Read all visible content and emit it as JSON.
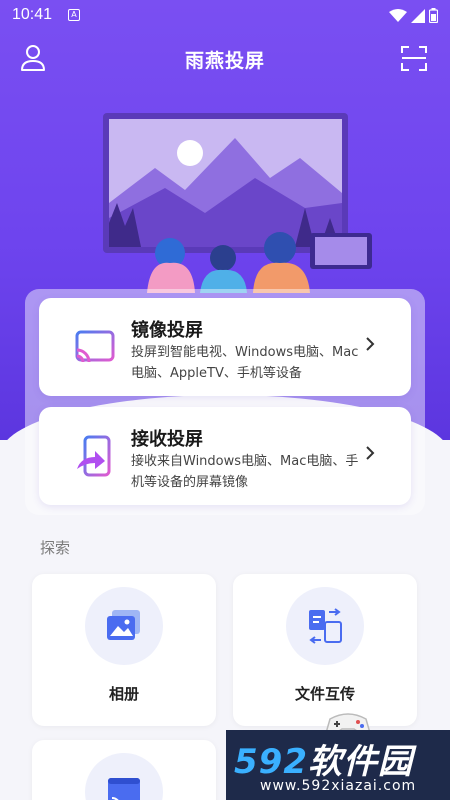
{
  "status_bar": {
    "time": "10:41",
    "app_indicator": "A"
  },
  "header": {
    "title": "雨燕投屏",
    "left_icon": "user-icon",
    "right_icon": "scan-icon"
  },
  "cards": [
    {
      "title": "镜像投屏",
      "desc": "投屏到智能电视、Windows电脑、Mac电脑、AppleTV、手机等设备",
      "icon": "cast-icon"
    },
    {
      "title": "接收投屏",
      "desc": "接收来自Windows电脑、Mac电脑、手机等设备的屏幕镜像",
      "icon": "receive-phone-icon"
    }
  ],
  "explore": {
    "heading": "探索",
    "tiles": [
      {
        "label": "相册",
        "icon": "album-icon"
      },
      {
        "label": "文件互传",
        "icon": "file-transfer-icon"
      },
      {
        "label": "",
        "icon": "browser-cast-icon"
      }
    ]
  },
  "watermark": {
    "brand_num": "592",
    "brand_text": "软件园",
    "url": "www.592xiazai.com"
  },
  "colors": {
    "primary": "#6e44ee",
    "accent_blue": "#4a7cf0",
    "accent_pink": "#e05bd0"
  }
}
